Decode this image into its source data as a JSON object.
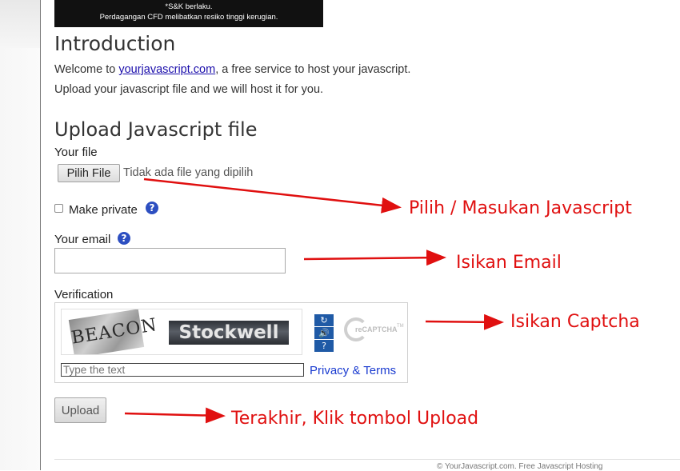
{
  "banner": {
    "line1": "*S&K berlaku.",
    "line2": "Perdagangan CFD melibatkan resiko tinggi kerugian."
  },
  "intro": {
    "title": "Introduction",
    "welcome_prefix": "Welcome to ",
    "site_link": "yourjavascript.com",
    "welcome_suffix": ", a free service to host your javascript.",
    "line2": "Upload your javascript file and we will host it for you."
  },
  "form": {
    "title": "Upload Javascript file",
    "file_label": "Your file",
    "file_button": "Pilih File",
    "file_status": "Tidak ada file yang dipilih",
    "make_private_label": "Make private",
    "make_private_checked": false,
    "email_label": "Your email",
    "email_value": "",
    "verification_label": "Verification",
    "upload_button": "Upload"
  },
  "captcha": {
    "word1": "BEACON",
    "word2": "Stockwell",
    "input_placeholder": "Type the text",
    "privacy_link": "Privacy & Terms",
    "buttons": [
      "refresh-icon",
      "audio-icon",
      "help-icon"
    ],
    "logo_text": "reCAPTCHA",
    "logo_tm": "TM"
  },
  "help_icon_glyph": "?",
  "annotations": {
    "file": "Pilih / Masukan Javascript",
    "email": "Isikan Email",
    "captcha": "Isikan Captcha",
    "upload": "Terakhir, Klik tombol Upload",
    "color": "#e01010"
  },
  "footer": {
    "text": "© YourJavascript.com. Free Javascript Hosting"
  }
}
